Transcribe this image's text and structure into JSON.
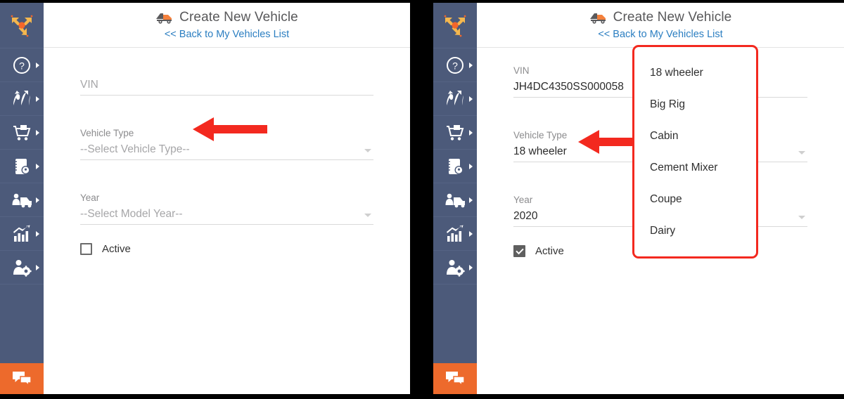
{
  "app": {
    "logo_icon": "three-way-arrow-logo",
    "sidebar_color": "#4c5a7a",
    "accent_color": "#ed6a2c",
    "link_color": "#2b7ec1",
    "annotation_color": "#f3291f"
  },
  "sidebar": {
    "items": [
      {
        "label": "help",
        "icon": "question-circle-icon"
      },
      {
        "label": "routes",
        "icon": "route-arrows-icon"
      },
      {
        "label": "orders",
        "icon": "shopping-cart-icon"
      },
      {
        "label": "locations",
        "icon": "address-book-pin-icon"
      },
      {
        "label": "fleet",
        "icon": "drivers-truck-icon"
      },
      {
        "label": "reports",
        "icon": "bar-chart-up-icon"
      },
      {
        "label": "users",
        "icon": "user-gear-icon"
      }
    ],
    "chat": {
      "icon": "chat-bubbles-icon"
    }
  },
  "header": {
    "icon": "tow-truck-icon",
    "title": "Create New Vehicle",
    "back_link": "<< Back to My Vehicles List"
  },
  "left_panel": {
    "vin": {
      "label": "VIN",
      "value": "",
      "placeholder": "VIN"
    },
    "vehicle_type": {
      "label": "Vehicle Type",
      "value": "--Select Vehicle Type--",
      "is_placeholder": true,
      "caret": "chevron-down-icon"
    },
    "year": {
      "label": "Year",
      "value": "--Select Model Year--",
      "is_placeholder": true,
      "caret": "chevron-down-icon"
    },
    "active": {
      "label": "Active",
      "checked": false
    }
  },
  "right_panel": {
    "vin": {
      "label": "VIN",
      "value": "JH4DC4350SS000058",
      "placeholder": "VIN"
    },
    "vehicle_type": {
      "label": "Vehicle Type",
      "value": "18 wheeler",
      "is_placeholder": false,
      "caret": "chevron-down-icon"
    },
    "year": {
      "label": "Year",
      "value": "2020",
      "is_placeholder": false,
      "caret": "chevron-down-icon"
    },
    "active": {
      "label": "Active",
      "checked": true
    }
  },
  "dropdown": {
    "name": "vehicle-type-options",
    "options": [
      "18 wheeler",
      "Big Rig",
      "Cabin",
      "Cement Mixer",
      "Coupe",
      "Dairy"
    ]
  },
  "annotations": [
    {
      "name": "arrow-left",
      "points_to": "vehicle-type-select"
    },
    {
      "name": "arrow-right",
      "points_to": "vehicle-type-select"
    }
  ]
}
